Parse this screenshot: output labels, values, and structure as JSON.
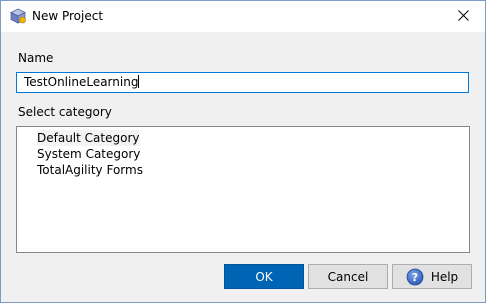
{
  "window": {
    "title": "New Project",
    "icon": "project-cube-icon",
    "close_icon": "close-icon"
  },
  "form": {
    "name_label": "Name",
    "name_value": "TestOnlineLearning",
    "category_label": "Select category",
    "categories": [
      {
        "label": "Default Category",
        "selected": true
      },
      {
        "label": "System Category",
        "selected": false
      },
      {
        "label": "TotalAgility Forms",
        "selected": false
      }
    ]
  },
  "buttons": {
    "ok_label": "OK",
    "cancel_label": "Cancel",
    "help_label": "Help",
    "help_icon": "help-question-icon"
  },
  "colors": {
    "accent": "#0064b4",
    "input_focus_border": "#0078d7",
    "window_border": "#7a9cc6",
    "dialog_background": "#f0f0f0"
  }
}
